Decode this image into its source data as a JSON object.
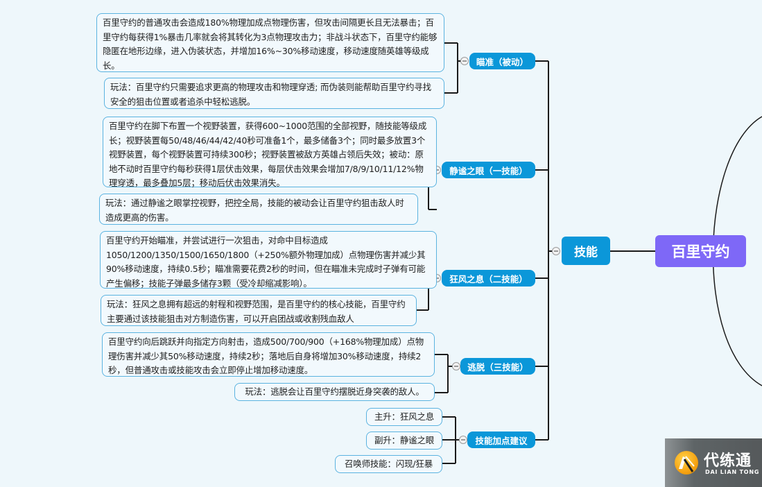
{
  "mindmap": {
    "root": {
      "label": "百里守约",
      "color": "#7e68f7"
    },
    "main": {
      "label": "技能",
      "color": "#0b97d9"
    },
    "branches": [
      {
        "label": "瞄准（被动）",
        "leaves": [
          "百里守约的普通攻击会造成180%物理加成点物理伤害，但攻击间隔更长且无法暴击；百里守约每获得1%暴击几率就会将其转化为3点物理攻击力；非战斗状态下，百里守约能够隐匿在地形边缘，进入伪装状态，并增加16%~30%移动速度，移动速度随英雄等级成长。",
          "玩法：百里守约只需要追求更高的物理攻击和物理穿透; 而伪装则能帮助百里守约寻找安全的狙击位置或者追杀中轻松逃脱。"
        ]
      },
      {
        "label": "静谧之眼（一技能）",
        "leaves": [
          "百里守约在脚下布置一个视野装置，获得600~1000范围的全部视野，随技能等级成长；视野装置每50/48/46/44/42/40秒可准备1个，最多储备3个；同时最多放置3个视野装置，每个视野装置可持续300秒；视野装置被敌方英雄占领后失效；被动：原地不动时百里守约每秒获得1层伏击效果，每层伏击效果会增加7/8/9/10/11/12%物理穿透，最多叠加5层；移动后伏击效果消失。",
          "玩法：通过静谧之眼掌控视野，把控全局，技能的被动会让百里守约狙击敌人时造成更高的伤害。"
        ]
      },
      {
        "label": "狂风之息（二技能）",
        "leaves": [
          "百里守约开始瞄准，并尝试进行一次狙击，对命中目标造成1050/1200/1350/1500/1650/1800（+250%额外物理加成）点物理伤害并减少其90%移动速度，持续0.5秒；瞄准需要花费2秒的时间，但在瞄准未完成时子弹有可能产生偏移；技能子弹最多储存3颗（受冷却缩减影响）。",
          "玩法：狂风之息拥有超远的射程和视野范围，是百里守约的核心技能，百里守约主要通过该技能狙击对方制造伤害，可以开启团战或收割残血敌人"
        ]
      },
      {
        "label": "逃脱（三技能）",
        "leaves": [
          "百里守约向后跳跃并向指定方向射击，造成500/700/900（+168%物理加成）点物理伤害并减少其50%移动速度，持续2秒；落地后自身将增加30%移动速度，持续2秒，但普通攻击或技能攻击会立即停止增加移动速度。",
          "玩法：逃脱会让百里守约摆脱近身突袭的敌人。"
        ]
      },
      {
        "label": "技能加点建议",
        "leaves": [
          "主升：狂风之息",
          "副升：静谧之眼",
          "召唤师技能：闪现/狂暴"
        ]
      }
    ]
  },
  "watermark": {
    "name_cn": "代练通",
    "name_en": "DAI LIAN TONG"
  },
  "colors": {
    "background": "#eef7fb",
    "branch": "#0b97d9",
    "leaf_border": "#5bb3e0",
    "root": "#7e68f7"
  }
}
